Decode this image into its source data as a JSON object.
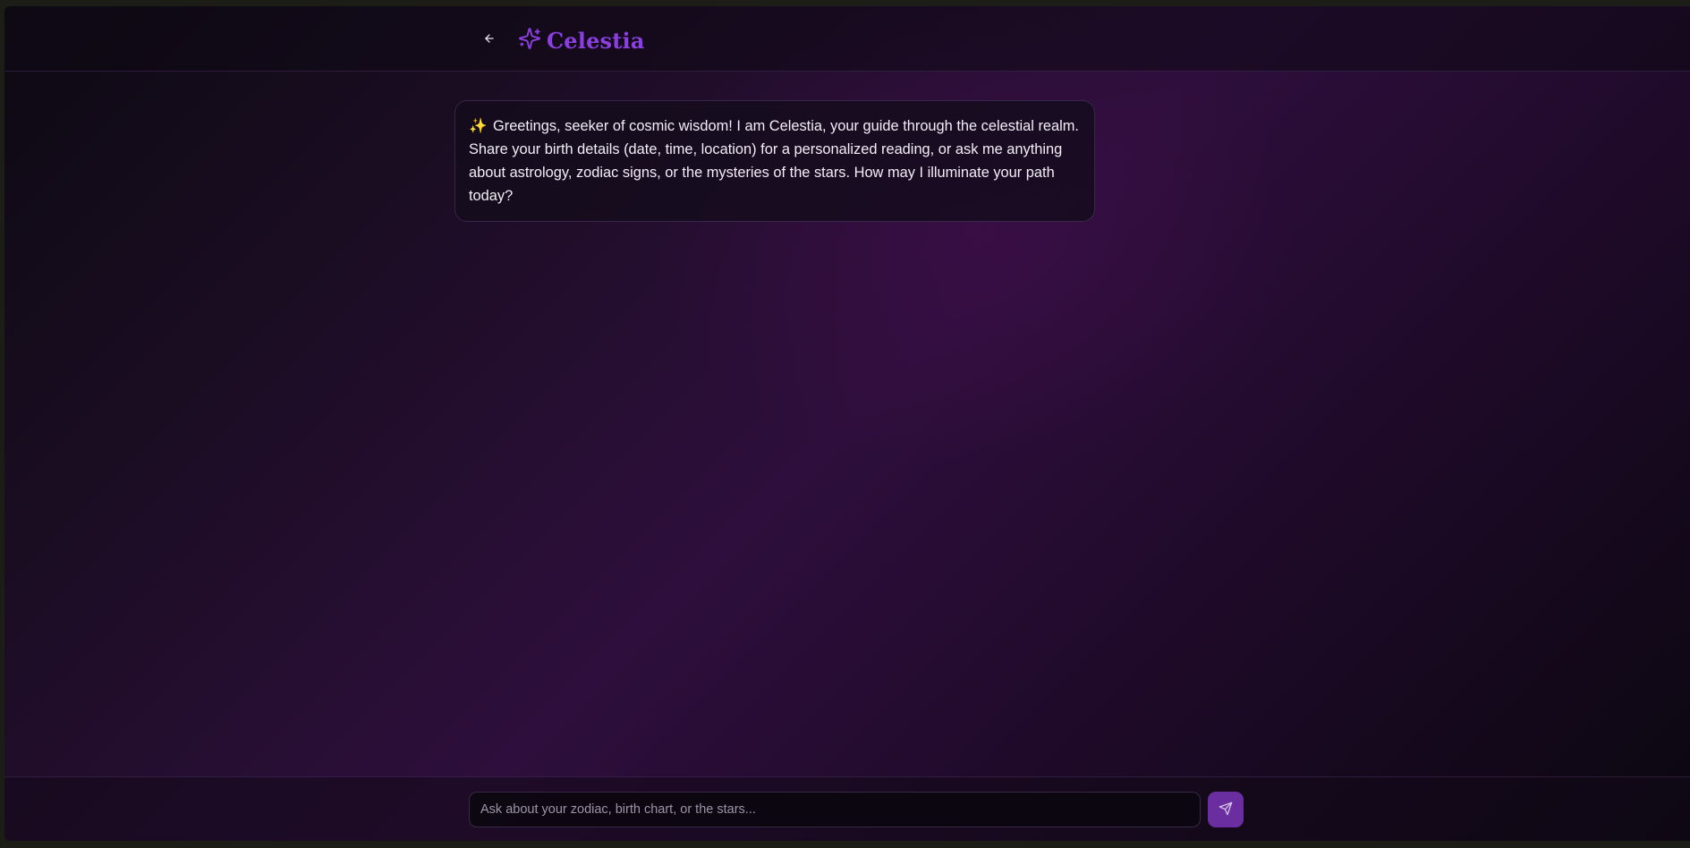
{
  "header": {
    "back_icon": "arrow-left-icon",
    "brand_icon": "sparkles-icon",
    "title": "Celestia"
  },
  "messages": [
    {
      "role": "assistant",
      "emoji": "✨",
      "text": "Greetings, seeker of cosmic wisdom! I am Celestia, your guide through the celestial realm. Share your birth details (date, time, location) for a personalized reading, or ask me anything about astrology, zodiac signs, or the mysteries of the stars. How may I illuminate your path today?"
    }
  ],
  "composer": {
    "placeholder": "Ask about your zodiac, birth chart, or the stars...",
    "value": "",
    "send_icon": "send-icon"
  },
  "colors": {
    "brand": "#8b3fe0",
    "send_button": "#6a2ea0",
    "background_accent": "#2e0e3c"
  }
}
